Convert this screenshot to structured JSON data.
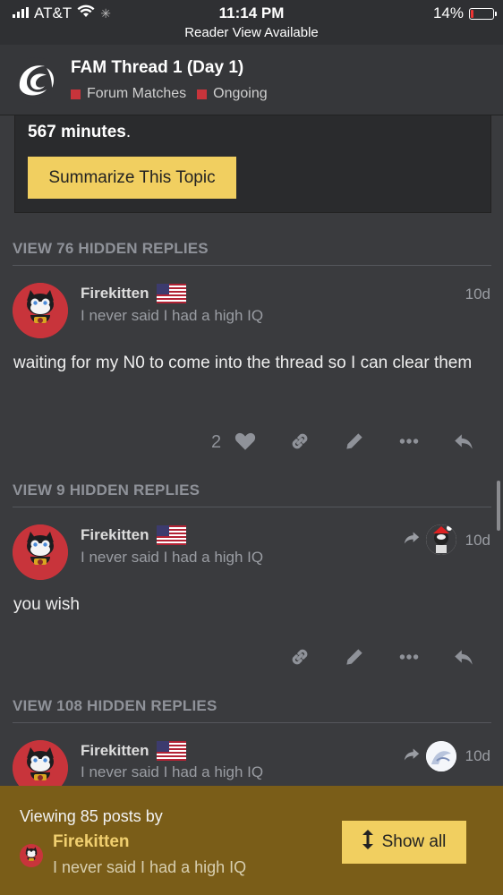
{
  "status_bar": {
    "carrier": "AT&T",
    "time": "11:14 PM",
    "reader_view": "Reader View Available",
    "battery": "14%",
    "battery_level": 0.14
  },
  "header": {
    "title": "FAM Thread 1 (Day 1)",
    "categories": [
      "Forum Matches",
      "Ongoing"
    ],
    "category_color": "#c8343b"
  },
  "summary": {
    "minutes_value": "567 minutes",
    "minutes_suffix": ".",
    "button_label": "Summarize This Topic"
  },
  "posts": [
    {
      "hidden_replies": "VIEW 76 HIDDEN REPLIES",
      "username": "Firekitten",
      "user_title": "I never said I had a high IQ",
      "age": "10d",
      "body": "waiting for my N0 to come into the thread so I can clear them",
      "like_count": "2"
    },
    {
      "hidden_replies": "VIEW 9 HIDDEN REPLIES",
      "username": "Firekitten",
      "user_title": "I never said I had a high IQ",
      "age": "10d",
      "body": "you wish"
    },
    {
      "hidden_replies": "VIEW 108 HIDDEN REPLIES",
      "username": "Firekitten",
      "user_title": "I never said I had a high IQ",
      "age": "10d"
    }
  ],
  "filter_bar": {
    "viewing_text": "Viewing 85 posts by",
    "username": "Firekitten",
    "user_title": "I never said I had a high IQ",
    "show_all_label": "Show all"
  },
  "colors": {
    "accent_yellow": "#f1cf60",
    "filter_bar_bg": "#7a5d18",
    "background": "#3a3b3e"
  }
}
